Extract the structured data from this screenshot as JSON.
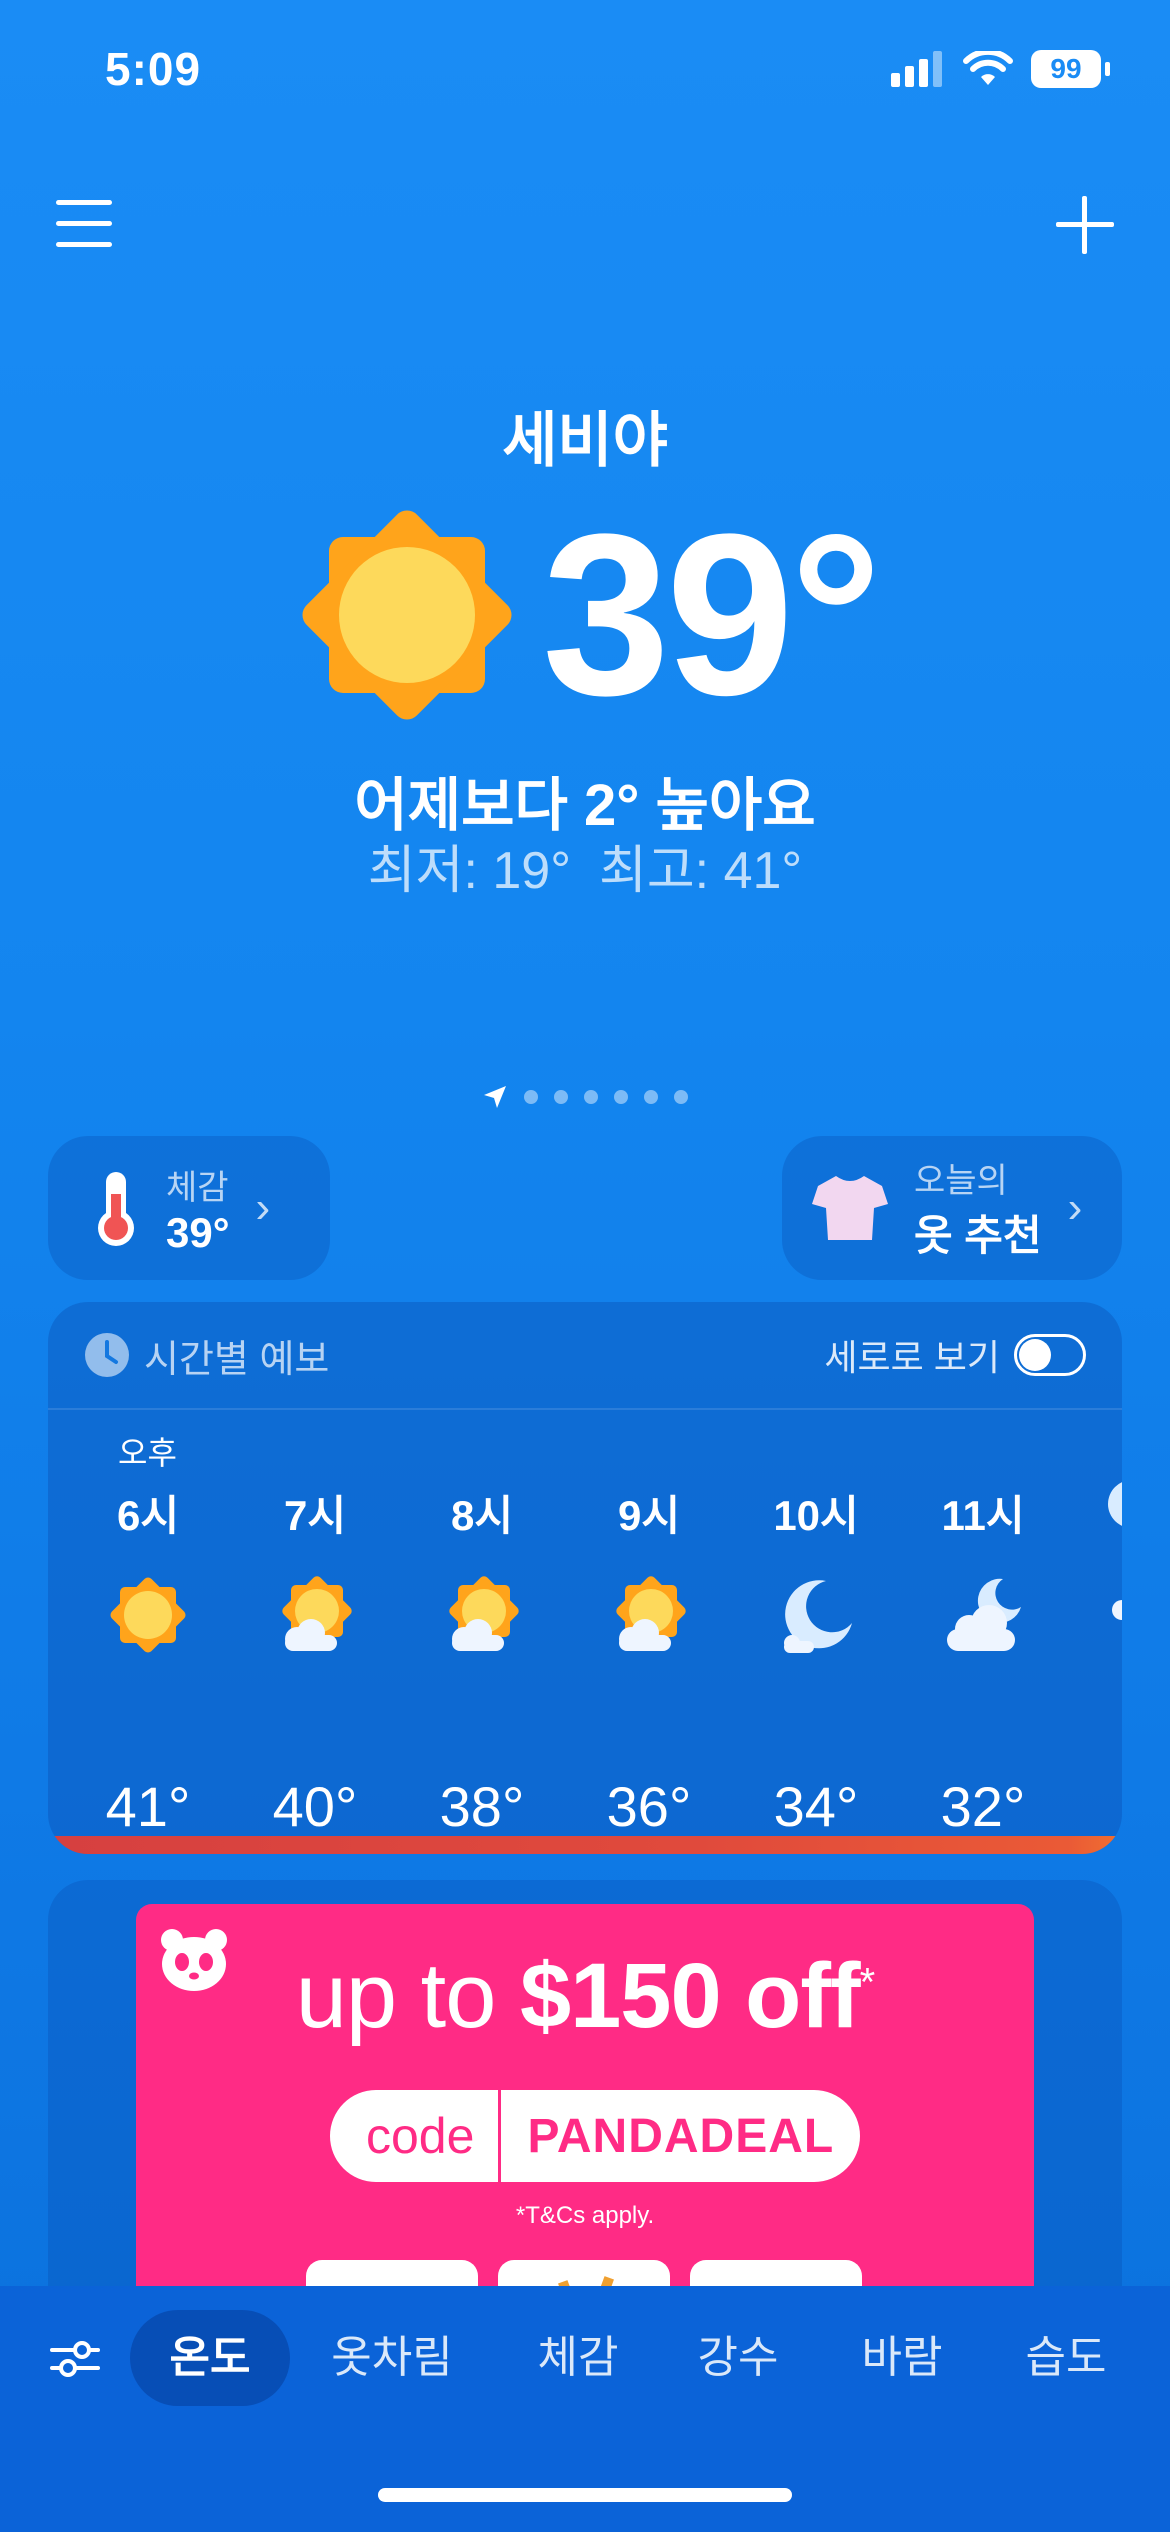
{
  "status_bar": {
    "time": "5:09",
    "battery": "99"
  },
  "header": {
    "menu_icon": "hamburger-menu-icon",
    "add_icon": "plus-icon"
  },
  "current": {
    "city": "세비야",
    "temperature": "39°",
    "comparison": "어제보다 2° 높아요",
    "low": "최저: 19°",
    "high": "최고: 41°",
    "icon": "sun-icon"
  },
  "pages": {
    "count": 7,
    "active": 0
  },
  "quick": {
    "feel_label": "체감",
    "feel_value": "39°",
    "clothes_label": "오늘의",
    "clothes_value": "옷 추천"
  },
  "hourly": {
    "title": "시간별 예보",
    "toggle_label": "세로로 보기",
    "toggle_on": false,
    "period_label": "오후",
    "items": [
      {
        "time": "6시",
        "icon": "sun",
        "temp": "41°"
      },
      {
        "time": "7시",
        "icon": "sun-cloud",
        "temp": "40°"
      },
      {
        "time": "8시",
        "icon": "sun-cloud",
        "temp": "38°"
      },
      {
        "time": "9시",
        "icon": "sun-cloud",
        "temp": "36°"
      },
      {
        "time": "10시",
        "icon": "moon",
        "temp": "34°"
      },
      {
        "time": "11시",
        "icon": "moon-cloud",
        "temp": "32°"
      }
    ]
  },
  "ad": {
    "headline_pre": "up to ",
    "headline_bold": "$150 off",
    "headline_star": "*",
    "code_label": "code",
    "code_value": "PANDADEAL",
    "terms": "*T&Cs apply."
  },
  "tabbar": {
    "filter_icon": "sliders-icon",
    "tabs": [
      "온도",
      "옷차림",
      "체감",
      "강수",
      "바람",
      "습도"
    ],
    "active": "온도"
  },
  "colors": {
    "background": "#1a8cf5",
    "sun": "#ffa41b",
    "ad_pink": "#ff2b85",
    "tabbar": "#0b63d8"
  }
}
